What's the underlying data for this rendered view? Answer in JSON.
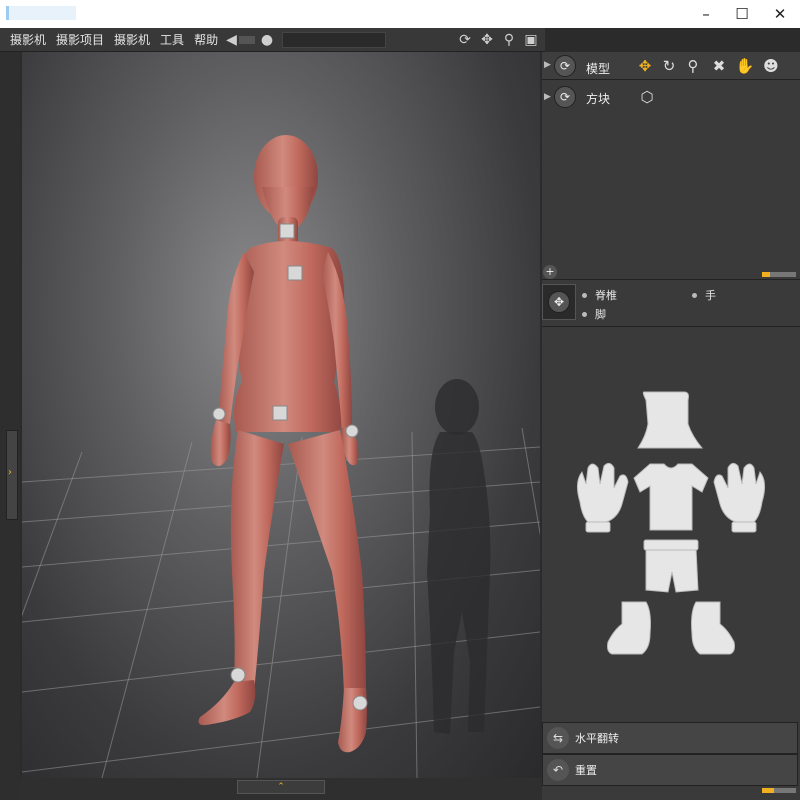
{
  "menu": {
    "items": [
      "摄影机",
      "摄影项目",
      "摄影机",
      "工具",
      "帮助"
    ]
  },
  "panel": {
    "model_label": "模型",
    "block_label": "方块",
    "parts": {
      "spine": "脊椎",
      "hand": "手",
      "foot": "脚"
    },
    "flip_label": "水平翻转",
    "reset_label": "重置"
  },
  "colors": {
    "accent": "#f0b020",
    "body": "#c5766b",
    "panel_bg": "#3a3a3a"
  },
  "icons": [
    "arrow-back-icon",
    "camera-icon",
    "rotate-icon",
    "move-icon",
    "zoom-icon",
    "snapshot-icon",
    "expand-icon",
    "add-icon",
    "flip-icon",
    "reset-icon"
  ]
}
